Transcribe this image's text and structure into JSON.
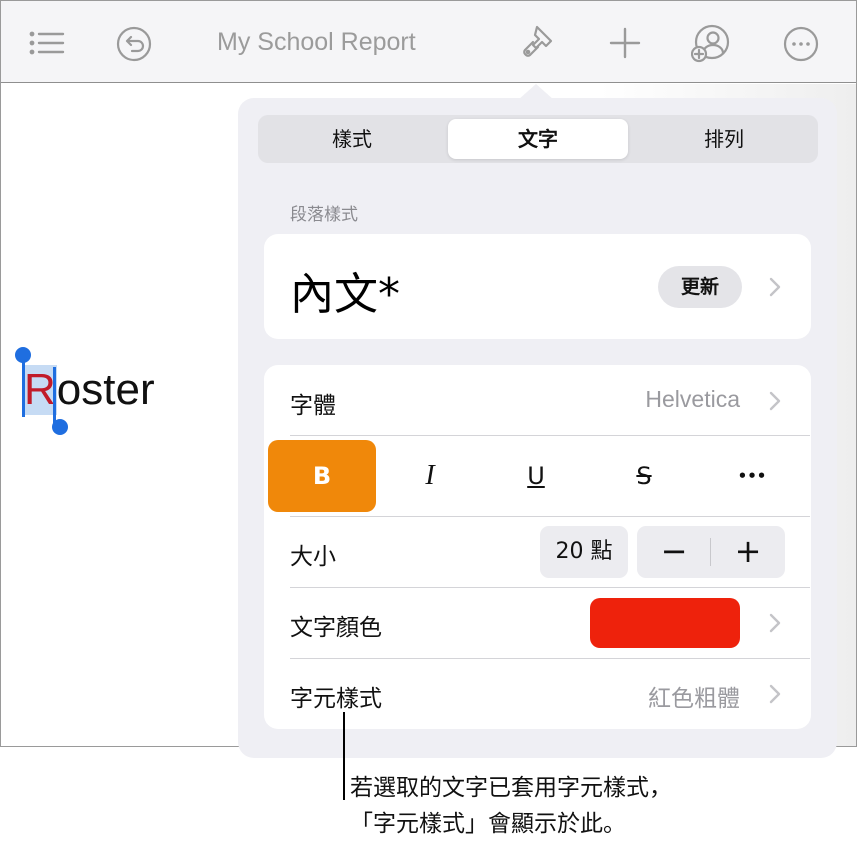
{
  "toolbar": {
    "title": "My School Report",
    "icons": [
      "list-icon",
      "undo-icon",
      "paintbrush-icon",
      "plus-icon",
      "collaborate-icon",
      "more-icon"
    ]
  },
  "document": {
    "selected_letter": "R",
    "rest_text": "oster"
  },
  "format_panel": {
    "tabs": [
      {
        "label": "樣式",
        "active": false
      },
      {
        "label": "文字",
        "active": true
      },
      {
        "label": "排列",
        "active": false
      }
    ],
    "paragraph_style_header": "段落樣式",
    "paragraph_style": "內文*",
    "update_button": "更新",
    "font_label": "字體",
    "font_value": "Helvetica",
    "format_buttons": {
      "bold": "B",
      "italic": "I",
      "underline": "U",
      "strikethrough": "S",
      "more": "•••"
    },
    "size_label": "大小",
    "size_value": "20 點",
    "size_decrease": "−",
    "size_increase": "+",
    "text_color_label": "文字顏色",
    "text_color": "#ee220c",
    "char_style_label": "字元樣式",
    "char_style_value": "紅色粗體"
  },
  "callout": {
    "line1": "若選取的文字已套用字元樣式，",
    "line2": "「字元樣式」會顯示於此。"
  },
  "colors": {
    "accent_orange": "#f0880a",
    "selection_blue": "#1f6ee0",
    "selected_text_red": "#c11b2a"
  }
}
